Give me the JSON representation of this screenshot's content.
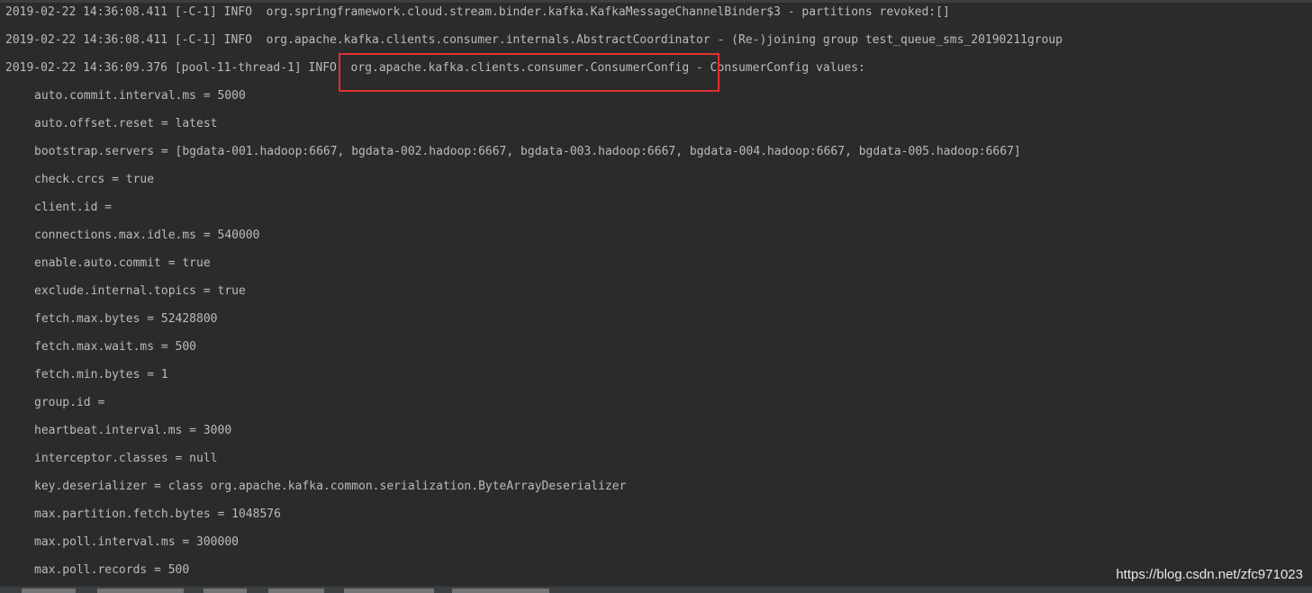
{
  "colors": {
    "background": "#2b2b2b",
    "text": "#bbbbbb",
    "highlight_border": "#e0312f"
  },
  "log_lines": [
    "2019-02-22 14:36:08.411 [-C-1] INFO  org.springframework.cloud.stream.binder.kafka.KafkaMessageChannelBinder$3 - partitions revoked:[]",
    "2019-02-22 14:36:08.411 [-C-1] INFO  org.apache.kafka.clients.consumer.internals.AbstractCoordinator - (Re-)joining group test_queue_sms_20190211group",
    "2019-02-22 14:36:09.376 [pool-11-thread-1] INFO  org.apache.kafka.clients.consumer.ConsumerConfig - ConsumerConfig values:"
  ],
  "config_lines": [
    "auto.commit.interval.ms = 5000",
    "auto.offset.reset = latest",
    "bootstrap.servers = [bgdata-001.hadoop:6667, bgdata-002.hadoop:6667, bgdata-003.hadoop:6667, bgdata-004.hadoop:6667, bgdata-005.hadoop:6667]",
    "check.crcs = true",
    "client.id =",
    "connections.max.idle.ms = 540000",
    "enable.auto.commit = true",
    "exclude.internal.topics = true",
    "fetch.max.bytes = 52428800",
    "fetch.max.wait.ms = 500",
    "fetch.min.bytes = 1",
    "group.id =",
    "heartbeat.interval.ms = 3000",
    "interceptor.classes = null",
    "key.deserializer = class org.apache.kafka.common.serialization.ByteArrayDeserializer",
    "max.partition.fetch.bytes = 1048576",
    "max.poll.interval.ms = 300000",
    "max.poll.records = 500"
  ],
  "watermark": "https://blog.csdn.net/zfc971023"
}
